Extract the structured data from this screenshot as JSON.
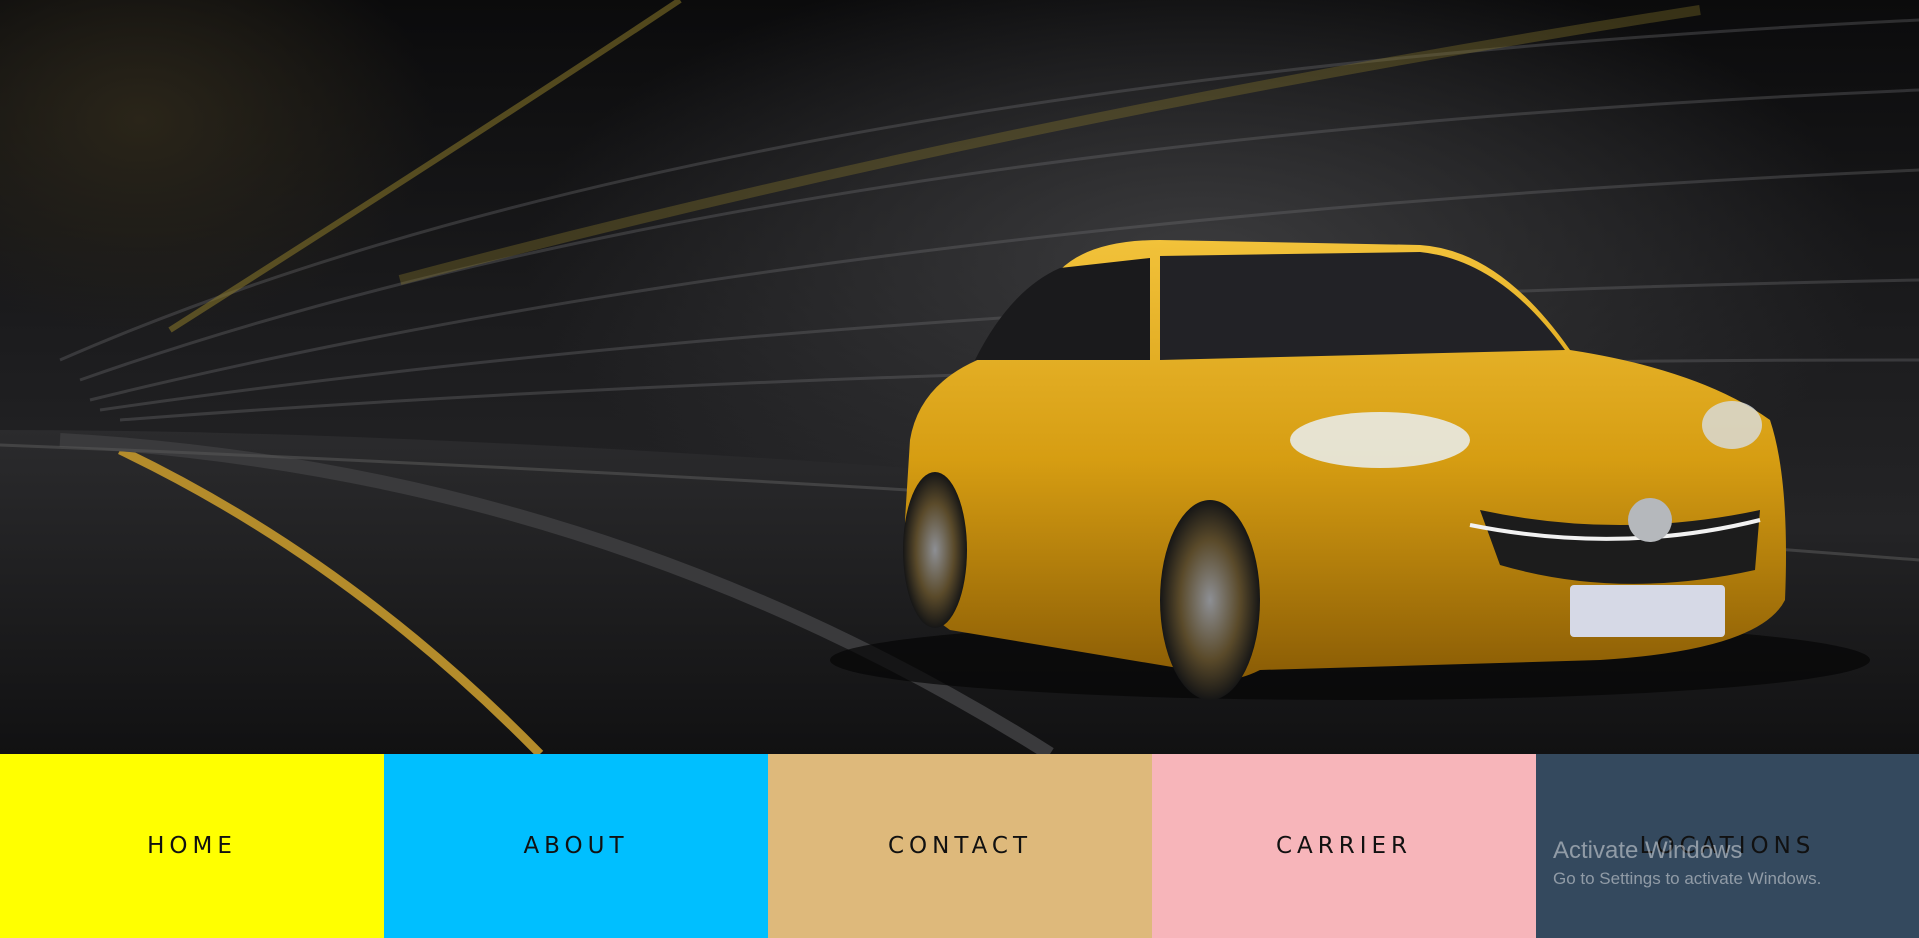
{
  "hero": {
    "image": "yellow-car-in-tunnel"
  },
  "nav": {
    "items": [
      {
        "label": "HOME",
        "color": "#FFFF00"
      },
      {
        "label": "ABOUT",
        "color": "#00BFFF"
      },
      {
        "label": "CONTACT",
        "color": "#DEB97B"
      },
      {
        "label": "CARRIER",
        "color": "#F7B5BA"
      },
      {
        "label": "LOCATIONS",
        "color": "#34495E"
      }
    ]
  },
  "watermark": {
    "title": "Activate Windows",
    "subtitle": "Go to Settings to activate Windows."
  }
}
